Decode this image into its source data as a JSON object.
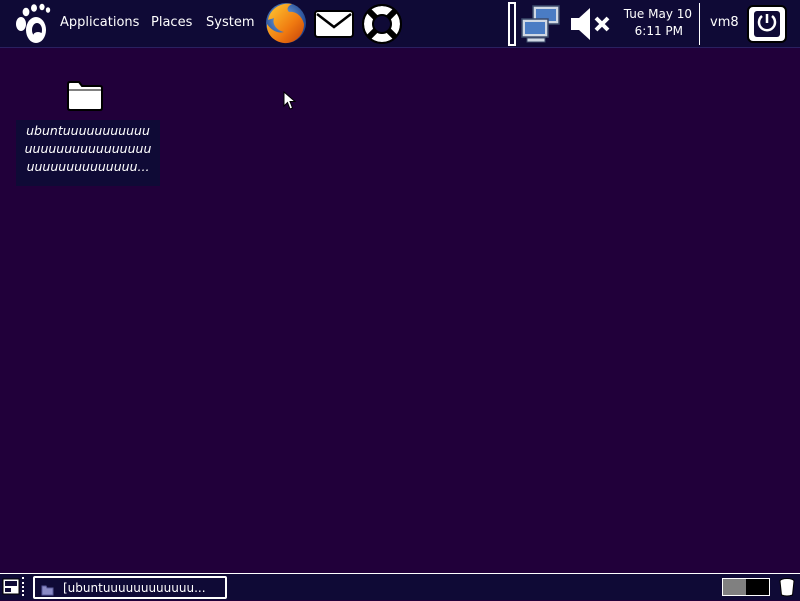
{
  "top_panel": {
    "menus": {
      "applications": "Applications",
      "places": "Places",
      "system": "System"
    },
    "launchers": [
      "firefox-icon",
      "mail-icon",
      "help-icon"
    ],
    "tray": [
      "network-icon",
      "volume-muted-icon"
    ],
    "clock": {
      "date": "Tue May 10",
      "time": "6:11 PM"
    },
    "user": "vm8"
  },
  "desktop": {
    "icons": [
      {
        "type": "folder-icon",
        "label_lines": [
          "ubuntuuuuuuuuuuu",
          "uuuuuuuuuuuuuuuu",
          "uuuuuuuuuuuuuu..."
        ]
      }
    ]
  },
  "bottom_panel": {
    "task_button": "[ubuntuuuuuuuuuuuu..."
  },
  "colors": {
    "panel": "#0f0a36",
    "desktop": "#21003a",
    "text": "#ffffff"
  }
}
